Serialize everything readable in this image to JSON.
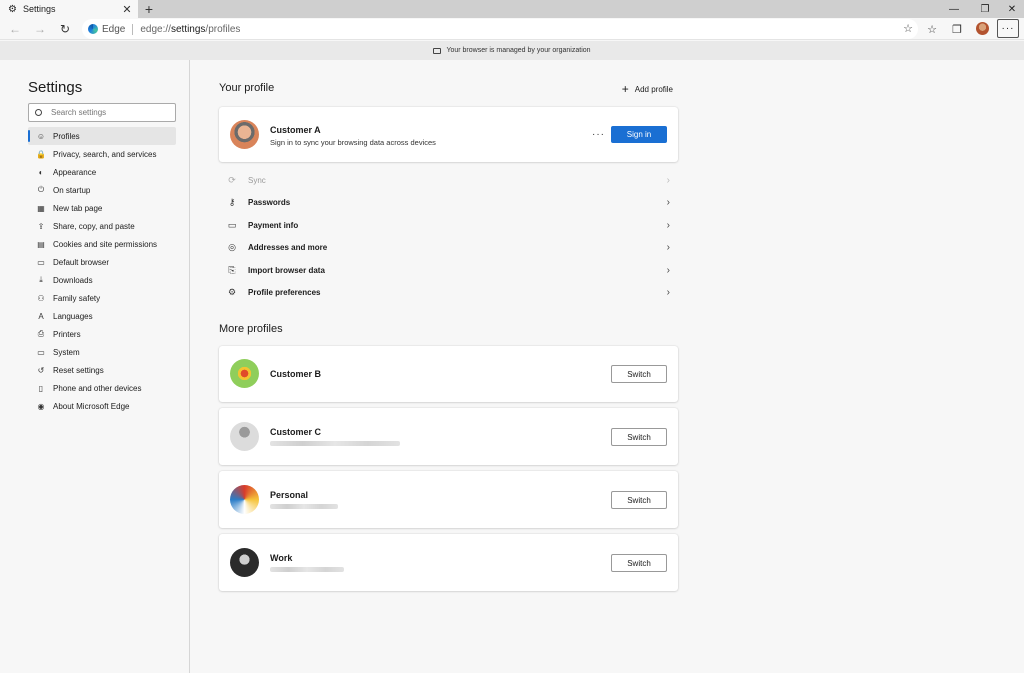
{
  "tab": {
    "title": "Settings",
    "close": "✕",
    "new_tab": "+"
  },
  "window": {
    "minimize": "—",
    "restore": "❐",
    "close": "✕"
  },
  "toolbar": {
    "back": "←",
    "forward": "→",
    "refresh": "↻",
    "address_label": "Edge",
    "url_prefix": "edge://",
    "url_path": "settings",
    "url_suffix": "/profiles",
    "menu": "···"
  },
  "managed_bar": {
    "text": "Your browser is managed by your organization"
  },
  "sidebar": {
    "title": "Settings",
    "search_placeholder": "Search settings",
    "items": [
      {
        "label": "Profiles",
        "icon": "profile-icon",
        "glyph": "☺"
      },
      {
        "label": "Privacy, search, and services",
        "icon": "lock-icon",
        "glyph": "🔒"
      },
      {
        "label": "Appearance",
        "icon": "appearance-icon",
        "glyph": "◐"
      },
      {
        "label": "On startup",
        "icon": "power-icon",
        "glyph": "⏻"
      },
      {
        "label": "New tab page",
        "icon": "newtab-icon",
        "glyph": "▦"
      },
      {
        "label": "Share, copy, and paste",
        "icon": "share-icon",
        "glyph": "⇪"
      },
      {
        "label": "Cookies and site permissions",
        "icon": "cookies-icon",
        "glyph": "▤"
      },
      {
        "label": "Default browser",
        "icon": "browser-icon",
        "glyph": "▭"
      },
      {
        "label": "Downloads",
        "icon": "download-icon",
        "glyph": "⤓"
      },
      {
        "label": "Family safety",
        "icon": "family-icon",
        "glyph": "⚇"
      },
      {
        "label": "Languages",
        "icon": "language-icon",
        "glyph": "A"
      },
      {
        "label": "Printers",
        "icon": "printer-icon",
        "glyph": "⎙"
      },
      {
        "label": "System",
        "icon": "system-icon",
        "glyph": "▭"
      },
      {
        "label": "Reset settings",
        "icon": "reset-icon",
        "glyph": "↺"
      },
      {
        "label": "Phone and other devices",
        "icon": "phone-icon",
        "glyph": "▯"
      },
      {
        "label": "About Microsoft Edge",
        "icon": "edge-icon",
        "glyph": "◉"
      }
    ]
  },
  "your_profile": {
    "title": "Your profile",
    "add_profile": "Add profile",
    "name": "Customer A",
    "subtitle": "Sign in to sync your browsing data across devices",
    "more": "···",
    "sign_in": "Sign in"
  },
  "settings_rows": [
    {
      "label": "Sync",
      "icon": "sync-icon",
      "glyph": "⟳",
      "disabled": true
    },
    {
      "label": "Passwords",
      "icon": "key-icon",
      "glyph": "⚷",
      "disabled": false
    },
    {
      "label": "Payment info",
      "icon": "card-icon",
      "glyph": "▭",
      "disabled": false
    },
    {
      "label": "Addresses and more",
      "icon": "location-icon",
      "glyph": "◎",
      "disabled": false
    },
    {
      "label": "Import browser data",
      "icon": "import-icon",
      "glyph": "⎘",
      "disabled": false
    },
    {
      "label": "Profile preferences",
      "icon": "profile-prefs-icon",
      "glyph": "⚙",
      "disabled": false
    }
  ],
  "chevron": "›",
  "more_profiles": {
    "title": "More profiles",
    "switch_label": "Switch",
    "profiles": [
      {
        "name": "Customer B"
      },
      {
        "name": "Customer C"
      },
      {
        "name": "Personal"
      },
      {
        "name": "Work"
      }
    ]
  }
}
